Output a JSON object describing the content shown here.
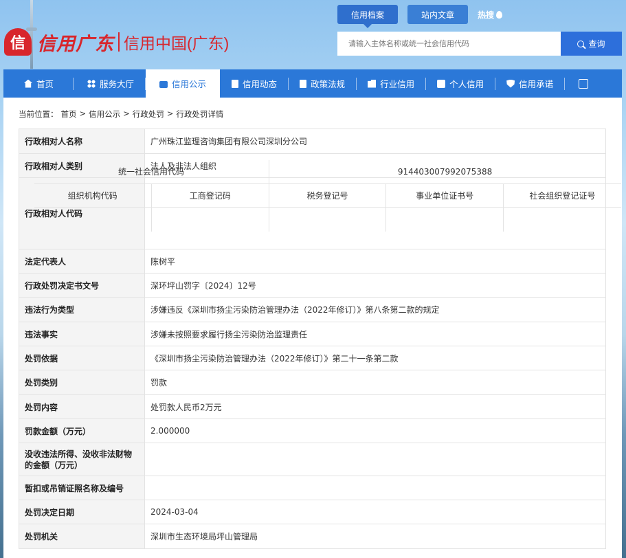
{
  "brand": {
    "mark": "信",
    "script": "信用广东",
    "name": "信用中国(广东)"
  },
  "top_tabs": [
    "信用档案",
    "站内文章"
  ],
  "hot": "热搜",
  "search": {
    "placeholder": "请输入主体名称或统一社会信用代码",
    "button": "查询"
  },
  "nav": [
    {
      "label": "首页",
      "icon": "home-icon"
    },
    {
      "label": "服务大厅",
      "icon": "grid-icon"
    },
    {
      "label": "信用公示",
      "icon": "briefcase-icon"
    },
    {
      "label": "信用动态",
      "icon": "document-icon"
    },
    {
      "label": "政策法规",
      "icon": "book-icon"
    },
    {
      "label": "行业信用",
      "icon": "building-icon"
    },
    {
      "label": "个人信用",
      "icon": "person-icon"
    },
    {
      "label": "信用承诺",
      "icon": "shield-icon"
    }
  ],
  "nav_expand_icon": "expand-icon",
  "breadcrumb": [
    "当前位置：",
    "首页",
    ">",
    "信用公示",
    ">",
    "行政处罚",
    ">",
    "行政处罚详情"
  ],
  "detail": {
    "name_label": "行政相对人名称",
    "name_value": "广州珠江监理咨询集团有限公司深圳分公司",
    "category_label": "行政相对人类别",
    "category_value": "法人及非法人组织",
    "code_label": "行政相对人代码",
    "credit_code_label": "统一社会信用代码",
    "credit_code_value": "914403007992075388",
    "org_code_label": "组织机构代码",
    "biz_reg_label": "工商登记码",
    "tax_reg_label": "税务登记号",
    "inst_cert_label": "事业单位证书号",
    "social_org_label": "社会组织登记证号",
    "legal_rep_label": "法定代表人",
    "legal_rep_value": "陈树平",
    "doc_no_label": "行政处罚决定书文号",
    "doc_no_value": "深环坪山罚字〔2024〕12号",
    "violation_type_label": "违法行为类型",
    "violation_type_value": "涉嫌违反《深圳市扬尘污染防治管理办法（2022年修订）》第八条第二款的规定",
    "facts_label": "违法事实",
    "facts_value": "涉嫌未按照要求履行扬尘污染防治监理责任",
    "basis_label": "处罚依据",
    "basis_value": "《深圳市扬尘污染防治管理办法（2022年修订）》第二十一条第二款",
    "penalty_type_label": "处罚类别",
    "penalty_type_value": "罚款",
    "content_label": "处罚内容",
    "content_value": "处罚款人民币2万元",
    "fine_label": "罚款金额（万元）",
    "fine_value": "2.000000",
    "confiscation_label": "没收违法所得、没收非法财物的金额（万元）",
    "confiscation_value": "",
    "license_label": "暂扣或吊销证照名称及编号",
    "license_value": "",
    "date_label": "处罚决定日期",
    "date_value": "2024-03-04",
    "authority_label": "处罚机关",
    "authority_value": "深圳市生态环境局坪山管理局"
  }
}
